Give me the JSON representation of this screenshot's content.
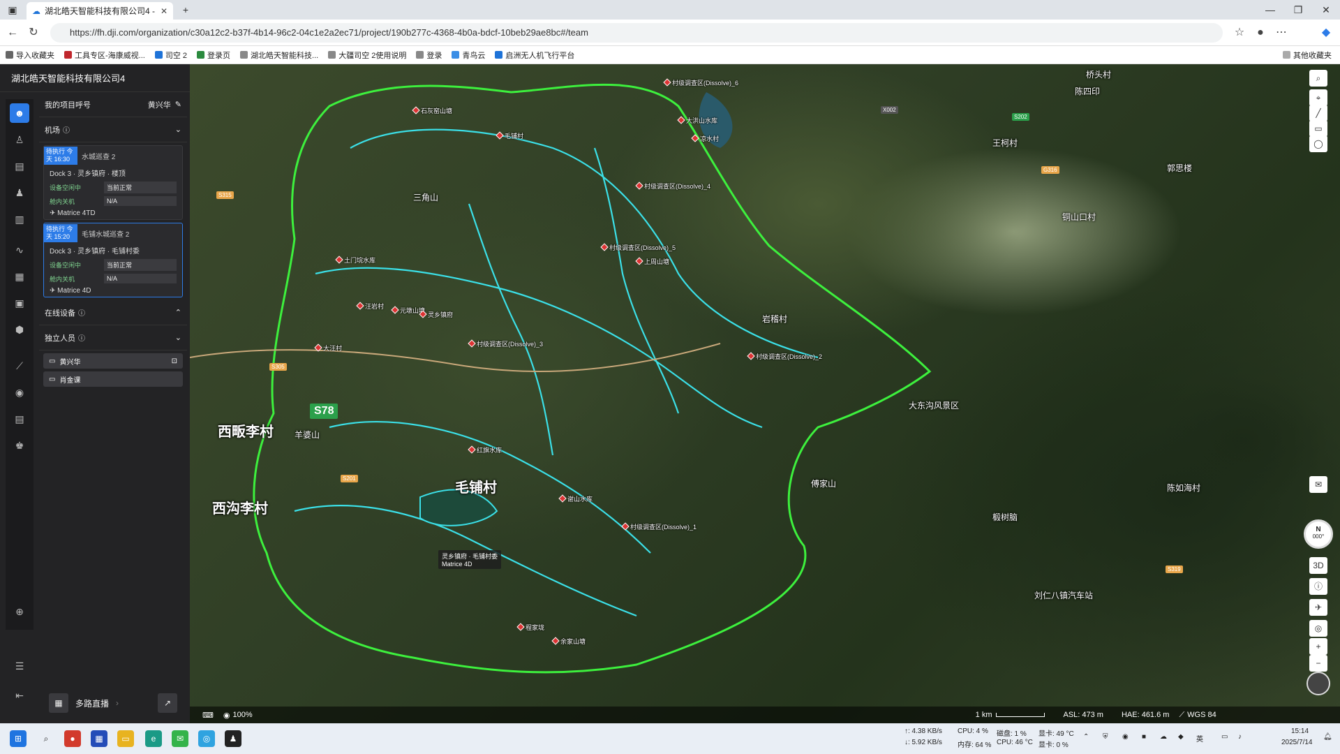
{
  "browser": {
    "tab_title": "湖北皓天智能科技有限公司4 - 湖",
    "url": "https://fh.dji.com/organization/c30a12c2-b37f-4b14-96c2-04c1e2a2ec71/project/190b277c-4368-4b0a-bdcf-10beb29ae8bc#/team",
    "bookmarks": [
      "导入收藏夹",
      "工具专区-海康威视...",
      "司空 2",
      "登录页",
      "湖北皓天智能科技...",
      "大疆司空 2使用说明",
      "登录",
      "青鸟云",
      "启洲无人机飞行平台"
    ],
    "other_bookmarks": "其他收藏夹"
  },
  "org": "湖北皓天智能科技有限公司4",
  "project": {
    "label": "我的项目呼号",
    "user": "黄兴华"
  },
  "sections": {
    "docks": "机场",
    "online_devices": "在线设备",
    "pilots": "独立人员"
  },
  "docks": [
    {
      "badge": "待执行 今天 16:30",
      "task": "水城巡查 2",
      "name": "Dock 3 · 灵乡镇府 · 楼顶",
      "status_label": "设备空闲中",
      "status_value": "当前正常",
      "aircraft_label": "舱内关机",
      "aircraft_value": "N/A",
      "drone": "Matrice 4TD"
    },
    {
      "badge": "待执行 今天 15:20",
      "task": "毛铺水城巡查 2",
      "name": "Dock 3 · 灵乡镇府 · 毛铺村委",
      "status_label": "设备空闲中",
      "status_value": "当前正常",
      "aircraft_label": "舱内关机",
      "aircraft_value": "N/A",
      "drone": "Matrice 4D"
    }
  ],
  "pilots": [
    "黄兴华",
    "肖金课"
  ],
  "bottom": {
    "live_label": "多路直播"
  },
  "map": {
    "big_places": [
      "西畈李村",
      "西沟李村",
      "毛铺村"
    ],
    "places": [
      "三角山",
      "桥头村",
      "陈四印",
      "王柯村",
      "郭思楼",
      "铜山口村",
      "岩稽村",
      "大东沟风景区",
      "傅家山",
      "羊婆山",
      "椴树脑",
      "刘仁八镇汽车站",
      "陈如海村"
    ],
    "pins": [
      "村级调查区(Dissolve)_6",
      "大洪山水库",
      "凉水村",
      "石灰窑山塘",
      "毛铺村",
      "村级调查区(Dissolve)_4",
      "村级调查区(Dissolve)_5",
      "村级调查区(Dissolve)_3",
      "村级调查区(Dissolve)_2",
      "村级调查区(Dissolve)_1",
      "上周山塘",
      "汪岩村",
      "土门垸水库",
      "元墩山塘",
      "大汪村",
      "灵乡镇府",
      "红旗水库",
      "谢山水库",
      "程家垅",
      "余家山塘"
    ],
    "roads": [
      "S78",
      "G316",
      "S315",
      "S201",
      "S202",
      "S305",
      "S319",
      "X002"
    ],
    "dock_popup": {
      "line1": "灵乡镇府 · 毛铺村委",
      "line2": "Matrice 4D"
    },
    "zoom": "100%",
    "scale": "1 km",
    "asl": "ASL: 473 m",
    "hae": "HAE: 461.6 m",
    "crs": "WGS 84",
    "compass_label": "N",
    "compass_value": "000°",
    "view_3d": "3D"
  },
  "taskbar": {
    "net_up": "↑: 4.38 KB/s",
    "net_down": "↓: 5.92 KB/s",
    "cpu": "CPU: 4 %",
    "mem": "内存: 64 %",
    "disk": "磁盘: 1 %",
    "cpu_temp": "CPU: 46 °C",
    "gpu_temp": "显卡: 49 °C",
    "gpu": "显卡: 0 %",
    "time": "15:14",
    "date": "2025/7/14"
  }
}
